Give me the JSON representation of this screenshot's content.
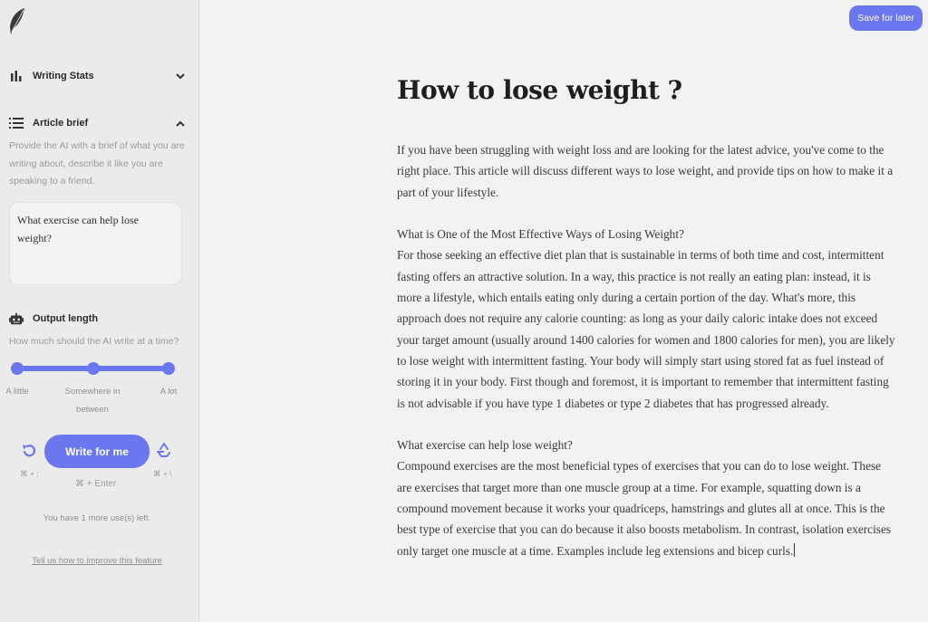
{
  "sidebar": {
    "logo_icon": "feather-icon",
    "writing_stats": {
      "label": "Writing Stats",
      "icon": "bar-chart-icon",
      "expanded": false
    },
    "article_brief": {
      "label": "Article brief",
      "icon": "list-icon",
      "expanded": true,
      "hint": "Provide the AI with a brief of what you are writing about, describe it like you are speaking to a friend.",
      "value": "What exercise can help lose weight?"
    },
    "output_length": {
      "label": "Output length",
      "icon": "robot-icon",
      "hint": "How much should the AI write at a time?",
      "options": [
        "A little",
        "Somewhere in between",
        "A lot"
      ],
      "selected": "A lot"
    },
    "write_button": "Write for me",
    "undo_shortcut": "⌘ + ;",
    "regenerate_shortcut": "⌘ + \\",
    "write_shortcut": "⌘ + Enter",
    "uses_left": "You have 1 more use(s) left.",
    "improve_link": "Tell us how to improve this feature"
  },
  "toolbar": {
    "save_label": "Save for later"
  },
  "article": {
    "title": "How to lose weight ?",
    "paragraphs": [
      "If you have been struggling with weight loss and are looking for the latest advice, you've come to the right place. This article will discuss different ways to lose weight, and provide tips on how to make it a part of your lifestyle.",
      "What is One of the Most Effective Ways of Losing Weight?",
      "For those seeking an effective diet plan that is sustainable in terms of both time and cost, intermittent fasting offers an attractive solution. In a way, this practice is not really an eating plan: instead, it is more a lifestyle, which entails eating only during a certain portion of the day. What's more, this approach does not require any calorie counting: as long as your daily caloric intake does not exceed your target amount (usually around 1400 calories for women and 1800 calories for men), you are likely to lose weight with intermittent fasting. Your body will simply start using stored fat as fuel instead of storing it in your body. First though and foremost, it is important to remember that intermittent fasting is not advisable if you have type 1 diabetes or type 2 diabetes that has progressed already.",
      "What exercise can help lose weight?",
      "Compound exercises are the most beneficial types of exercises that you can do to lose weight. These are exercises that target more than one muscle group at a time. For example, squatting down is a compound movement because it works your quadriceps, hamstrings and glutes all at once. This is the best type of exercise that you can do because it also boosts metabolism. In contrast, isolation exercises only target one muscle at a time. Examples include leg extensions and bicep curls."
    ]
  },
  "colors": {
    "accent": "#6b77ee",
    "sidebar_bg": "#ebebeb",
    "page_bg": "#f2f2f2"
  }
}
